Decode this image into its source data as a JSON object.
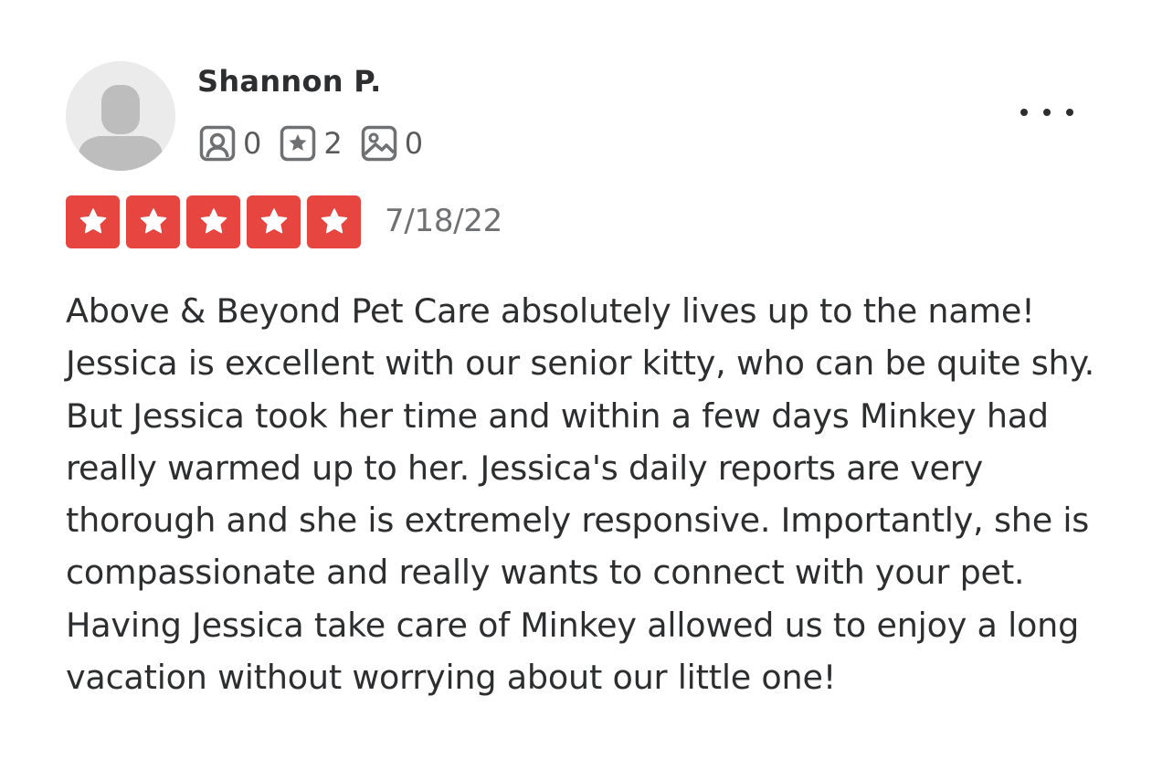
{
  "review": {
    "user": {
      "name": "Shannon P.",
      "avatar_icon": "default-user-avatar-icon"
    },
    "stats": [
      {
        "icon": "friends-icon",
        "value": "0"
      },
      {
        "icon": "reviews-star-icon",
        "value": "2"
      },
      {
        "icon": "photos-icon",
        "value": "0"
      }
    ],
    "more_icon": "more-options-icon",
    "rating": 5,
    "rating_max": 5,
    "date": "7/18/22",
    "text": "Above & Beyond Pet Care absolutely lives up to the name! Jessica is excellent with our senior kitty, who can be quite shy. But Jessica took her time and within a few days Minkey had really warmed up to her. Jessica's daily reports are very thorough and she is extremely responsive. Importantly, she is compassionate and really wants to connect with your pet. Having Jessica take care of Minkey allowed us to enjoy a long vacation without worrying about our little one!",
    "colors": {
      "star_fill": "#e6463f",
      "text": "#2d2e2f",
      "secondary_text": "#6e7072",
      "avatar_bg": "#ebebeb",
      "avatar_figure": "#bdbdbd"
    }
  }
}
